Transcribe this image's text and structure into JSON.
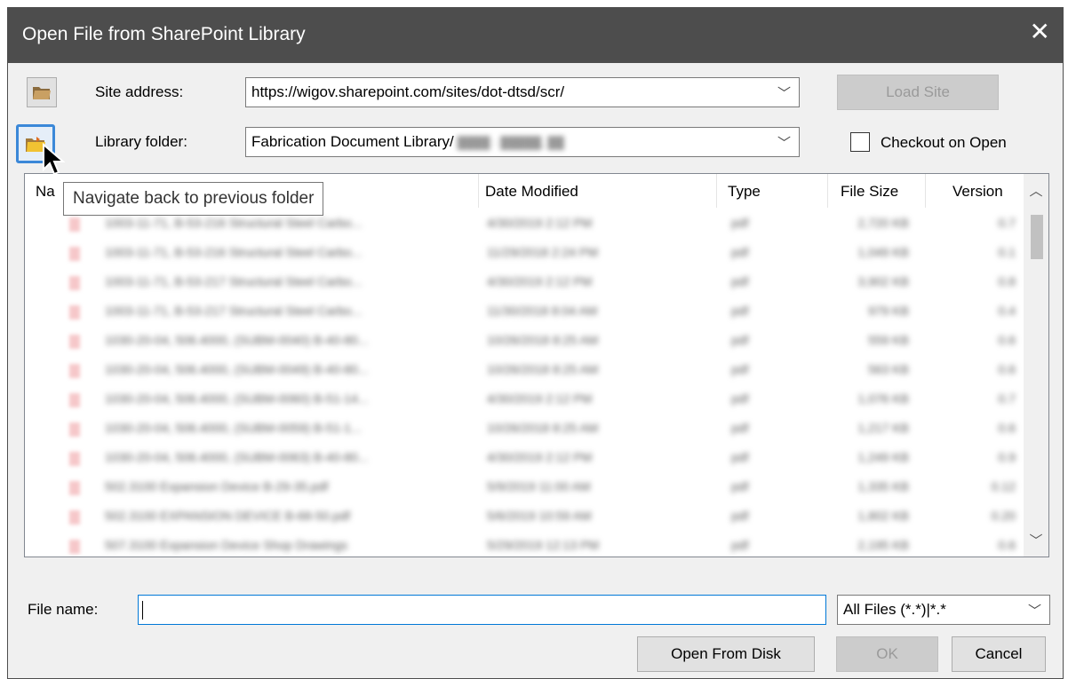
{
  "window": {
    "title": "Open File from SharePoint Library",
    "close_glyph": "✕"
  },
  "site": {
    "label": "Site address:",
    "value": "https://wigov.sharepoint.com/sites/dot-dtsd/scr/",
    "load_label": "Load Site"
  },
  "library": {
    "label": "Library folder:",
    "value": "Fabrication Document Library/",
    "checkout_label": "Checkout on Open"
  },
  "tooltip": "Navigate back to previous folder",
  "columns": {
    "name": "Na",
    "date": "Date Modified",
    "type": "Type",
    "size": "File Size",
    "version": "Version"
  },
  "files": [
    {
      "name": "1003-11-71, B-53-216 Structural Steel Carbo...",
      "date": "4/30/2019 2:12 PM",
      "type": "pdf",
      "size": "2,720 KB",
      "version": "0.7"
    },
    {
      "name": "1003-11-71, B-53-216 Structural Steel Carbo...",
      "date": "11/29/2018 2:24 PM",
      "type": "pdf",
      "size": "1,049 KB",
      "version": "0.1"
    },
    {
      "name": "1003-11-71, B-53-217 Structural Steel Carbo...",
      "date": "4/30/2019 2:12 PM",
      "type": "pdf",
      "size": "3,902 KB",
      "version": "0.8"
    },
    {
      "name": "1003-11-71, B-53-217 Structural Steel Carbo...",
      "date": "11/30/2018 8:04 AM",
      "type": "pdf",
      "size": "979 KB",
      "version": "0.4"
    },
    {
      "name": "1030-20-04, 506.4000, (SUBM-0040) B-40-80...",
      "date": "10/26/2018 8:25 AM",
      "type": "pdf",
      "size": "559 KB",
      "version": "0.6"
    },
    {
      "name": "1030-20-04, 506.4000, (SUBM-0049) B-40-80...",
      "date": "10/26/2018 8:25 AM",
      "type": "pdf",
      "size": "563 KB",
      "version": "0.6"
    },
    {
      "name": "1030-20-04, 506.4000, (SUBM-0060) B-51-14...",
      "date": "4/30/2019 2:12 PM",
      "type": "pdf",
      "size": "1,076 KB",
      "version": "0.7"
    },
    {
      "name": "1030-20-04, 506.4000, (SUBM-0059) B-51-1...",
      "date": "10/26/2018 8:25 AM",
      "type": "pdf",
      "size": "1,217 KB",
      "version": "0.6"
    },
    {
      "name": "1030-20-04, 506.4000, (SUBM-0063) B-40-80...",
      "date": "4/30/2019 2:12 PM",
      "type": "pdf",
      "size": "1,249 KB",
      "version": "0.9"
    },
    {
      "name": "502.3100 Expansion Device B-29-35.pdf",
      "date": "5/9/2019 11:00 AM",
      "type": "pdf",
      "size": "1,335 KB",
      "version": "0.12"
    },
    {
      "name": "502.3100 EXPANSION DEVICE B-68-50.pdf",
      "date": "5/6/2019 10:59 AM",
      "type": "pdf",
      "size": "1,802 KB",
      "version": "0.20"
    },
    {
      "name": "507.3100 Expansion Device Shop Drawings",
      "date": "5/29/2019 12:13 PM",
      "type": "pdf",
      "size": "2,195 KB",
      "version": "0.6"
    }
  ],
  "filename": {
    "label": "File name:",
    "value": ""
  },
  "filter": {
    "value": "All Files (*.*)|*.*"
  },
  "buttons": {
    "open_disk": "Open From Disk",
    "ok": "OK",
    "cancel": "Cancel"
  },
  "icons": {
    "folder_open": "folder-open-icon",
    "folder_back": "folder-back-icon",
    "pdf": "pdf-file-icon",
    "chevron": "chevron-down-icon"
  },
  "colors": {
    "titlebar": "#4d4d4d",
    "focus": "#3b88d8",
    "disabled": "#cccccc"
  }
}
